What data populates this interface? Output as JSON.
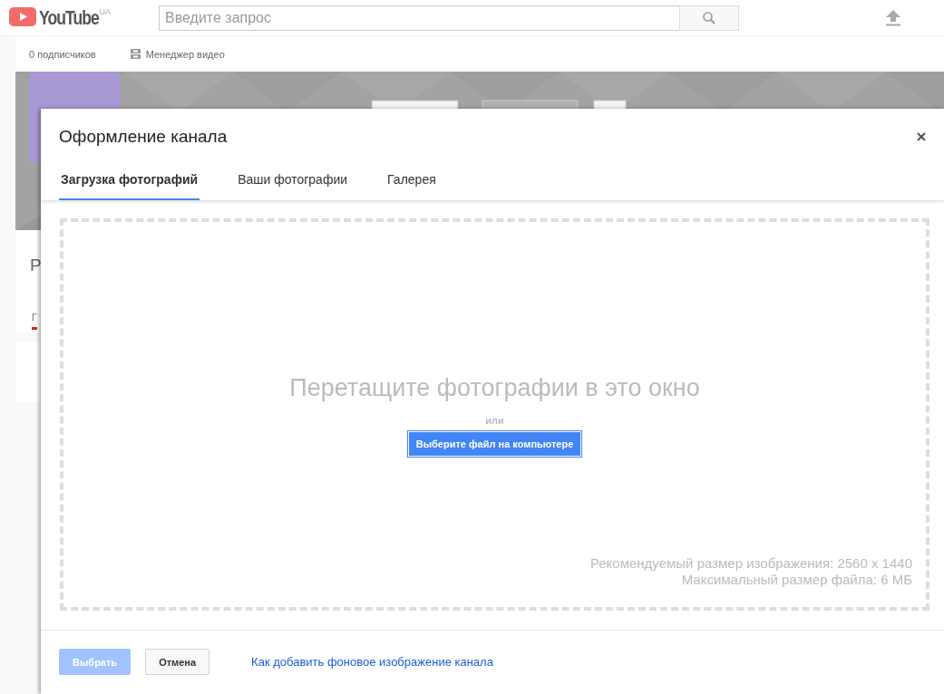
{
  "header": {
    "logo": "YouTube",
    "region": "UA",
    "search": {
      "placeholder": "Введите запрос"
    }
  },
  "channel_bar": {
    "subscribers": "0 подписчиков",
    "video_manager": "Менеджер видео"
  },
  "channel": {
    "name_partial": "Р",
    "tab_partial": "Г"
  },
  "dialog": {
    "title": "Оформление канала",
    "tabs": [
      {
        "label": "Загрузка фотографий",
        "selected": true
      },
      {
        "label": "Ваши фотографии",
        "selected": false
      },
      {
        "label": "Галерея",
        "selected": false
      }
    ],
    "drop_zone": {
      "heading": "Перетащите фотографии в это окно",
      "or": "или",
      "choose_button": "Выберите файл на компьютере",
      "recommended": "Рекомендуемый размер изображения: 2560 x 1440",
      "max_size": "Максимальный размер файла: 6 МБ"
    },
    "buttons": [
      {
        "label": "Выбрать",
        "kind": "primary",
        "disabled": true
      },
      {
        "label": "Отмена",
        "kind": "secondary",
        "disabled": false
      }
    ],
    "help_link": "Как добавить фоновое изображение канала"
  }
}
